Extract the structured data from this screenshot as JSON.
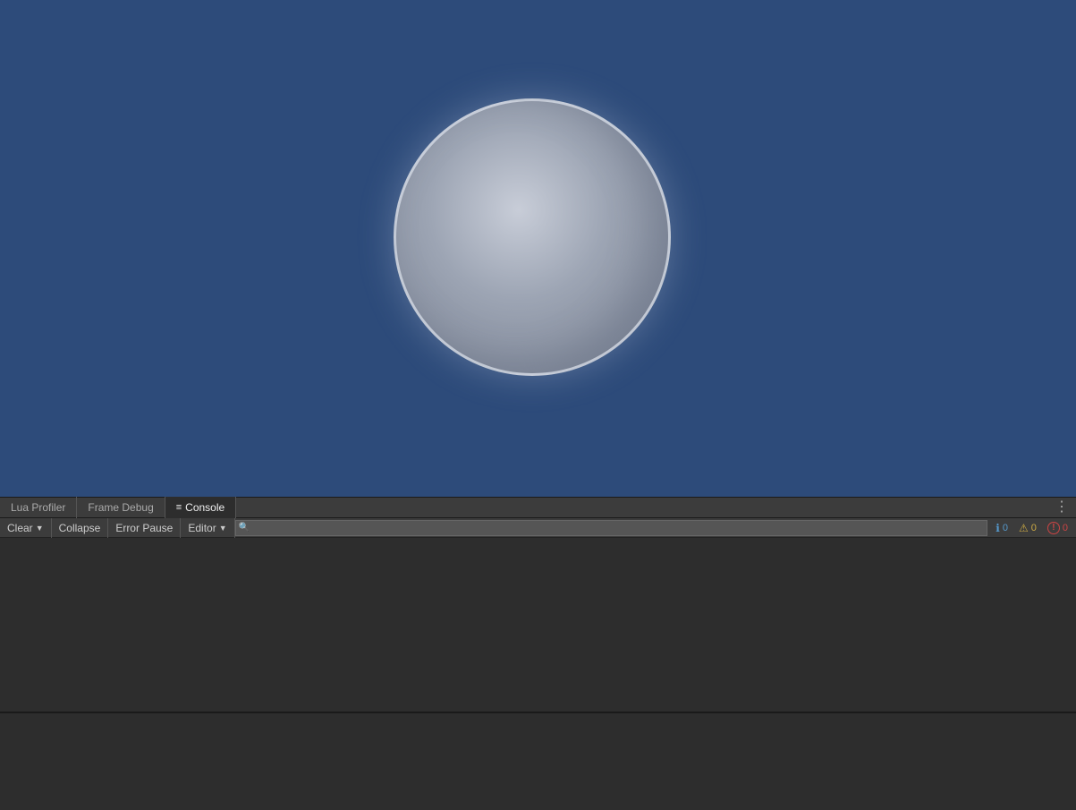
{
  "viewport": {
    "background_color": "#2d4b7a"
  },
  "sphere": {
    "visible": true
  },
  "tabs": {
    "items": [
      {
        "id": "lua-profiler",
        "label": "Lua Profiler",
        "active": false,
        "icon": ""
      },
      {
        "id": "frame-debug",
        "label": "Frame Debug",
        "active": false,
        "icon": ""
      },
      {
        "id": "console",
        "label": "Console",
        "active": true,
        "icon": "≡"
      }
    ],
    "menu_icon": "⋮"
  },
  "toolbar": {
    "clear_label": "Clear",
    "collapse_label": "Collapse",
    "error_pause_label": "Error Pause",
    "editor_label": "Editor",
    "search_placeholder": ""
  },
  "badges": [
    {
      "id": "info",
      "icon": "ℹ",
      "count": "0",
      "color": "#5599cc"
    },
    {
      "id": "warning",
      "icon": "⚠",
      "count": "0",
      "color": "#ccaa44"
    },
    {
      "id": "error",
      "icon": "!",
      "count": "0",
      "color": "#cc4444"
    }
  ],
  "console": {
    "log_entries": []
  }
}
